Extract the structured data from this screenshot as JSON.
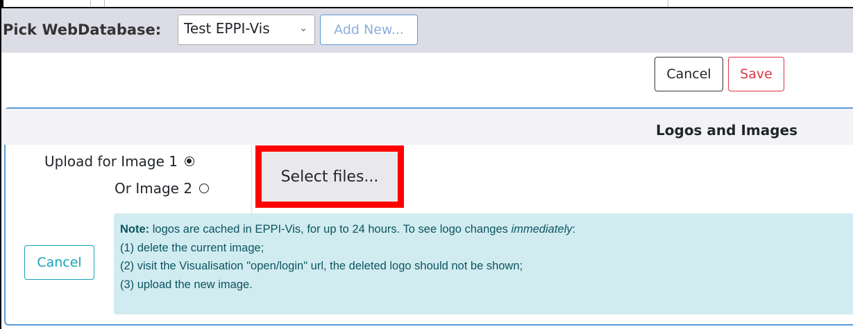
{
  "picker": {
    "label": "Pick WebDatabase:",
    "selected": "Test EPPI-Vis",
    "add_new_label": "Add New..."
  },
  "top_actions": {
    "cancel_label": "Cancel",
    "save_label": "Save"
  },
  "panel": {
    "title": "Logos and Images",
    "upload_image1_label": "Upload for Image 1",
    "upload_image2_label": "Or Image 2",
    "image1_selected": true,
    "select_files_label": "Select files...",
    "cancel_label": "Cancel"
  },
  "note": {
    "prefix": "Note:",
    "line1_start": " logos are cached in EPPI-Vis, for up to 24 hours. To see logo changes ",
    "line1_emph": "immediately",
    "line1_end": ":",
    "line2": "(1) delete the current image;",
    "line3": "(2) visit the Visualisation \"open/login\" url, the deleted logo should not be shown;",
    "line4": "(3) upload the new image."
  },
  "colors": {
    "accent_blue": "#5b9bd5",
    "danger": "#dc3545",
    "info": "#17a2b8",
    "note_bg": "#d1ecf1",
    "highlight": "#ff0000"
  }
}
